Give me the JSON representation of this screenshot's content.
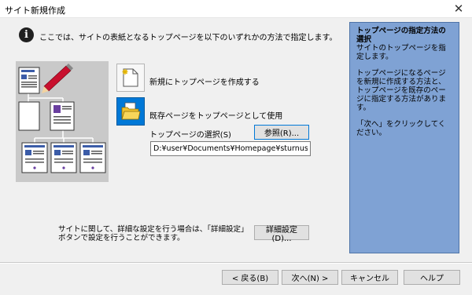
{
  "window": {
    "title": "サイト新規作成",
    "close_label": "✕"
  },
  "intro": {
    "icon": "info-icon",
    "text": "ここでは、サイトの表紙となるトップページを以下のいずれかの方法で指定します。"
  },
  "options": {
    "new_label": "新規にトップページを作成する",
    "existing_label": "既存ページをトップページとして使用",
    "selected": "existing"
  },
  "toppage": {
    "label": "トップページの選択(S)",
    "browse_label": "参照(R)...",
    "path": "D:¥user¥Documents¥Homepage¥sturnus¥homepage"
  },
  "detail": {
    "text": "サイトに関して、詳細な設定を行う場合は、「詳細設定」ボタンで設定を行うことができます。",
    "button_label": "詳細設定(D)..."
  },
  "side_panel": {
    "title": "トップページの指定方法の選択",
    "paragraphs": [
      "サイトのトップページを指定します。",
      "トップページになるページを新規に作成する方法と、トップページを既存のページに指定する方法があります。",
      "「次へ」をクリックしてください。"
    ],
    "bg_color": "#7fa2d4"
  },
  "footer": {
    "back_label": "< 戻る(B)",
    "next_label": "次へ(N) >",
    "cancel_label": "キャンセル",
    "help_label": "ヘルプ"
  }
}
